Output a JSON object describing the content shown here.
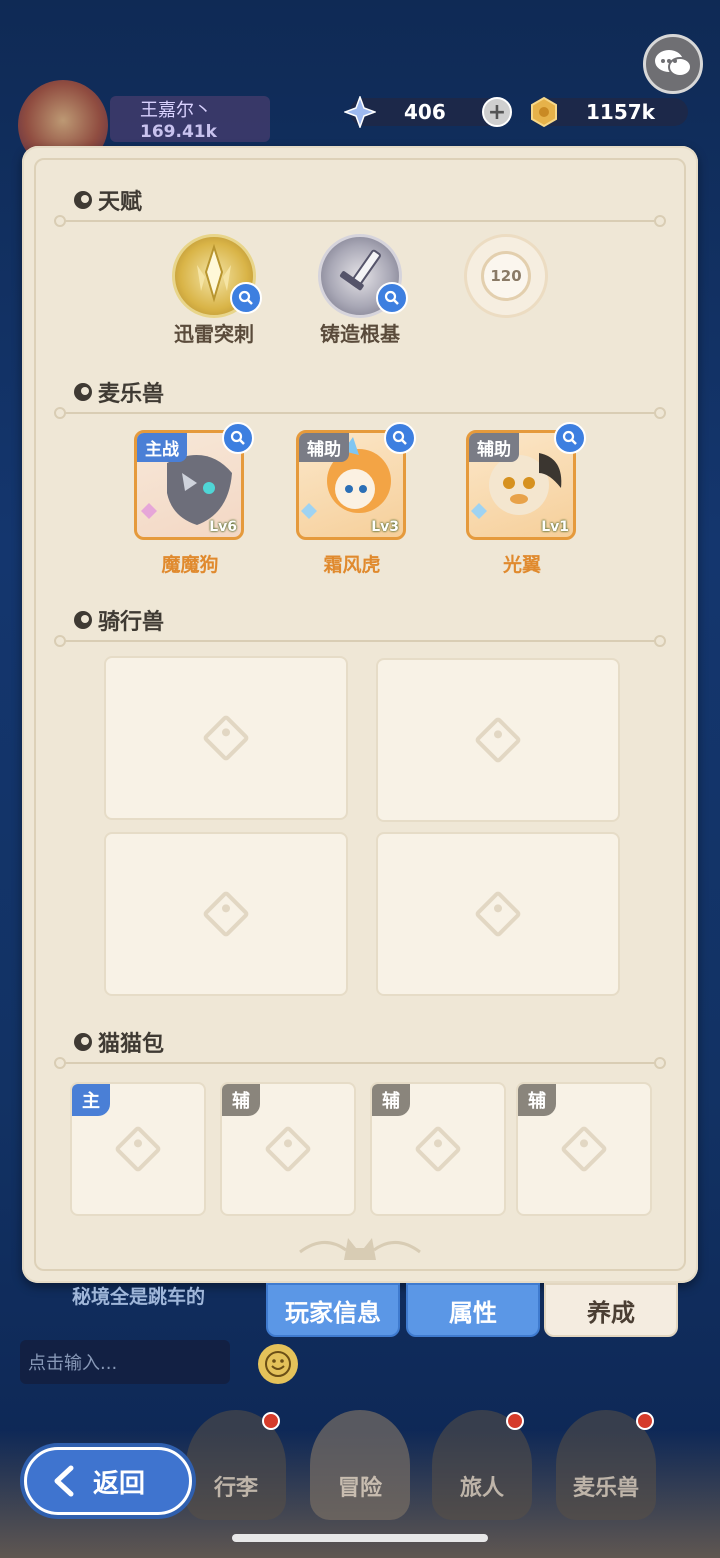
{
  "header": {
    "player_name": "王嘉尔丶",
    "power": "169.41k",
    "gems": "406",
    "coins": "1157k"
  },
  "sections": {
    "talent": {
      "title": "天赋",
      "items": [
        {
          "label": "迅雷突刺"
        },
        {
          "label": "铸造根基"
        },
        {
          "label": "120"
        }
      ]
    },
    "pets": {
      "title": "麦乐兽",
      "items": [
        {
          "tag": "主战",
          "level": "Lv6",
          "name": "魔魔狗"
        },
        {
          "tag": "辅助",
          "level": "Lv3",
          "name": "霜风虎"
        },
        {
          "tag": "辅助",
          "level": "Lv1",
          "name": "光翼"
        }
      ]
    },
    "mounts": {
      "title": "骑行兽"
    },
    "catbag": {
      "title": "猫猫包",
      "tags": [
        "主",
        "辅",
        "辅",
        "辅"
      ]
    }
  },
  "tabs": [
    "玩家信息",
    "属性",
    "养成"
  ],
  "chat": {
    "message": "秘境全是跳车的",
    "input_placeholder": "点击输入..."
  },
  "bottom_nav": [
    "行李",
    "冒险",
    "旅人",
    "麦乐兽"
  ],
  "back_label": "返回",
  "colors": {
    "accent_blue": "#5b97e6",
    "pet_name": "#e08a2e",
    "panel": "#efe7d6"
  }
}
